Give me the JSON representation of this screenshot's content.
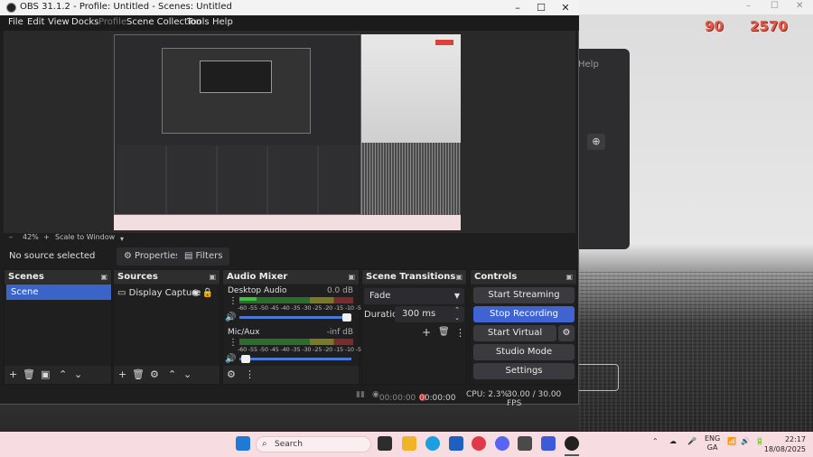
{
  "window": {
    "title": "OBS 31.1.2 - Profile: Untitled - Scenes: Untitled",
    "minimize": "–",
    "maximize": "☐",
    "close": "✕"
  },
  "menu": [
    "File",
    "Edit",
    "View",
    "Docks",
    "Profile",
    "Scene Collection",
    "Tools",
    "Help"
  ],
  "zoom": {
    "minus": "–",
    "value": "42%",
    "plus": "+",
    "scale_to_window": "Scale to Window",
    "dropdown": "▾"
  },
  "source_toolbar": {
    "no_source": "No source selected",
    "properties": "Properties",
    "filters": "Filters"
  },
  "scenes": {
    "title": "Scenes",
    "items": [
      "Scene"
    ]
  },
  "sources": {
    "title": "Sources",
    "items": [
      "Display Capture"
    ]
  },
  "mixer": {
    "title": "Audio Mixer",
    "scale": "-60 -55 -50 -45 -40 -35 -30 -25 -20 -15 -10 -5 0",
    "channels": [
      {
        "name": "Desktop Audio",
        "db": "0.0 dB",
        "level": 0.15,
        "volume": 1.0
      },
      {
        "name": "Mic/Aux",
        "db": "-inf dB",
        "level": 0.0,
        "volume": 0.02
      }
    ]
  },
  "transitions": {
    "title": "Scene Transitions",
    "type": "Fade",
    "duration_label": "Duration",
    "duration_value": "300 ms"
  },
  "controls": {
    "title": "Controls",
    "start_streaming": "Start Streaming",
    "stop_recording": "Stop Recording",
    "start_virtual_camera": "Start Virtual Camera",
    "studio_mode": "Studio Mode",
    "settings": "Settings"
  },
  "status": {
    "stream_time": "00:00:00",
    "rec_time": "00:00:00",
    "cpu": "CPU: 2.3%",
    "fps": "30.00 / 30.00 FPS"
  },
  "background": {
    "help": "Help",
    "score_a": "90",
    "score_b": "2570"
  },
  "taskbar": {
    "search": "Search",
    "lang": "ENG",
    "region": "GA",
    "time": "22:17",
    "date": "18/08/2025"
  },
  "colors": {
    "accent": "#3f63d1",
    "record": "#e02828",
    "taskbar": "#f7dde1"
  }
}
